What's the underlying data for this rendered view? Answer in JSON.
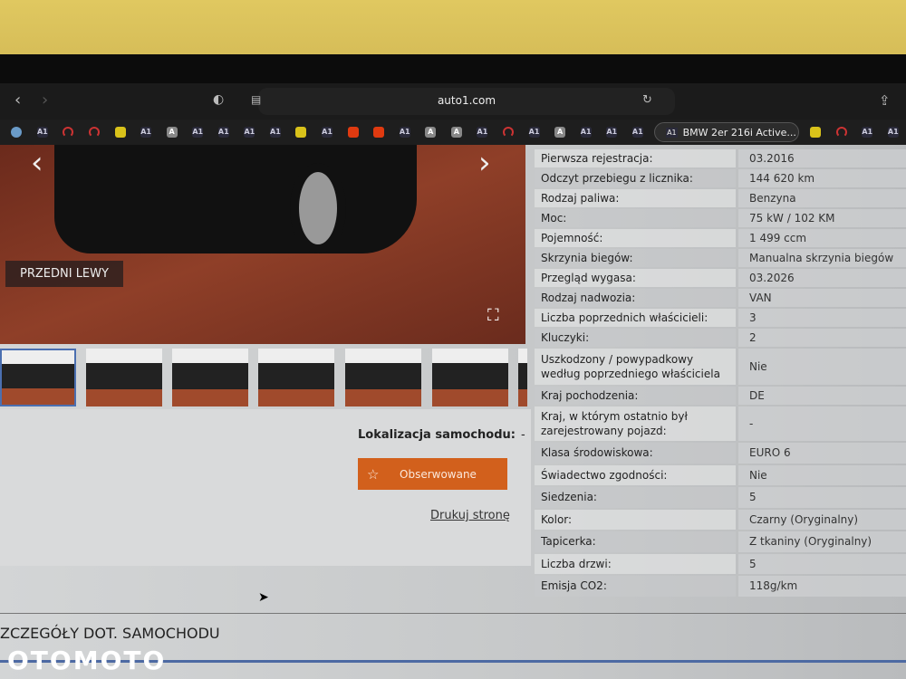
{
  "browser": {
    "url": "auto1.com",
    "active_tab": "BMW 2er 216i Active...",
    "tab_icons": [
      "globe",
      "a1",
      "red",
      "red",
      "yellow",
      "a1",
      "a",
      "a1",
      "a1",
      "a1",
      "a1",
      "yellow",
      "a1",
      "orange",
      "orange",
      "a1",
      "a",
      "a",
      "a1",
      "red",
      "a1",
      "a",
      "a1",
      "a1",
      "a1"
    ],
    "tab_icons_after": [
      "yellow",
      "red",
      "a1",
      "a1"
    ],
    "tab_a1_text": "A1",
    "tab_a_text": "A"
  },
  "gallery": {
    "label": "PRZEDNI LEWY",
    "thumb_count": 6
  },
  "actions": {
    "location_label": "Lokalizacja samochodu:",
    "location_value": "-",
    "watch_button": "Obserwowane",
    "print_link": "Drukuj stronę"
  },
  "specs": [
    {
      "label": "Pierwsza rejestracja:",
      "value": "03.2016"
    },
    {
      "label": "Odczyt przebiegu z licznika:",
      "value": "144 620 km"
    },
    {
      "label": "Rodzaj paliwa:",
      "value": "Benzyna"
    },
    {
      "label": "Moc:",
      "value": "75 kW / 102 KM"
    },
    {
      "label": "Pojemność:",
      "value": "1 499 ccm"
    },
    {
      "label": "Skrzynia biegów:",
      "value": "Manualna skrzynia biegów"
    },
    {
      "label": "Przegląd wygasa:",
      "value": "03.2026"
    },
    {
      "label": "Rodzaj nadwozia:",
      "value": "VAN"
    },
    {
      "label": "Liczba poprzednich właścicieli:",
      "value": "3"
    },
    {
      "label": "Kluczyki:",
      "value": "2"
    },
    {
      "label": "Uszkodzony / powypadkowy według poprzedniego właściciela",
      "value": "Nie"
    },
    {
      "label": "Kraj pochodzenia:",
      "value": "DE"
    },
    {
      "label": "Kraj, w którym ostatnio był zarejestrowany pojazd:",
      "value": "-"
    },
    {
      "label": "Klasa środowiskowa:",
      "value": "EURO 6"
    },
    {
      "label": "Świadectwo zgodności:",
      "value": "Nie"
    },
    {
      "label": "Siedzenia:",
      "value": "5"
    },
    {
      "label": "Kolor:",
      "value": "Czarny (Oryginalny)"
    },
    {
      "label": "Tapicerka:",
      "value": "Z tkaniny (Oryginalny)"
    },
    {
      "label": "Liczba drzwi:",
      "value": "5"
    },
    {
      "label": "Emisja CO2:",
      "value": "118g/km"
    }
  ],
  "section_title": "ZCZEGÓŁY DOT. SAMOCHODU",
  "watermark": "OTOMOTO"
}
